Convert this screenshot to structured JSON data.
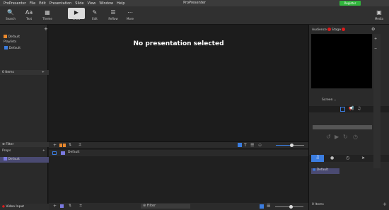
{
  "app": {
    "title": "ProPresenter",
    "register": "Register"
  },
  "menu": [
    "ProPresenter",
    "File",
    "Edit",
    "Presentation",
    "Slide",
    "View",
    "Window",
    "Help"
  ],
  "toolbar": {
    "search": "Search",
    "text": "Text",
    "theme": "Theme",
    "show": "Show",
    "edit": "Edit",
    "reflow": "Reflow",
    "more": "More",
    "media": "Media"
  },
  "left": {
    "default_library": "Default",
    "playlists": "Playlists",
    "default_playlist": "Default",
    "items_header": "0 Items",
    "filter": "Filter",
    "bottom_section": "Props",
    "bottom_default": "Default",
    "video_input": "Video Input"
  },
  "main": {
    "empty_message": "No presentation selected",
    "lib_default": "Default",
    "filter": "Filter"
  },
  "right": {
    "audience": "Audience",
    "stage": "Stage",
    "screen": "Screen",
    "default_audio": "Default",
    "items": "0 Items"
  },
  "colors": {
    "accent": "#31b53c",
    "red": "#e01b1b",
    "blue": "#3b7de0",
    "orange": "#e7872d"
  }
}
